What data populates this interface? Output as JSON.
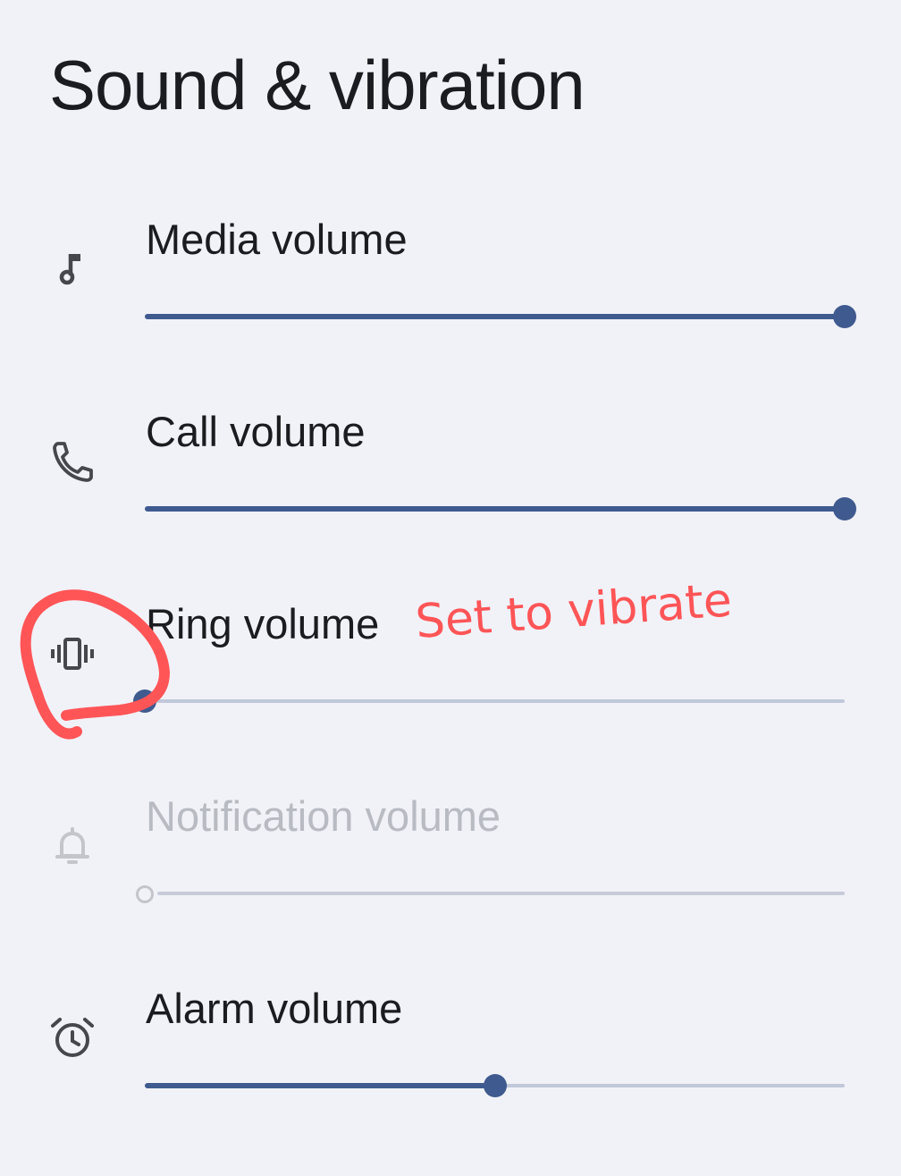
{
  "header": {
    "title": "Sound & vibration"
  },
  "rows": [
    {
      "label": "Media volume",
      "icon": "music-note-icon",
      "level_percent": 100,
      "enabled": true
    },
    {
      "label": "Call volume",
      "icon": "phone-icon",
      "level_percent": 100,
      "enabled": true
    },
    {
      "label": "Ring volume",
      "icon": "vibrate-icon",
      "level_percent": 0,
      "enabled": true
    },
    {
      "label": "Notification volume",
      "icon": "bell-icon",
      "level_percent": 0,
      "enabled": false
    },
    {
      "label": "Alarm volume",
      "icon": "alarm-clock-icon",
      "level_percent": 50,
      "enabled": true
    }
  ],
  "annotation": {
    "text": "Set to vibrate",
    "color": "#ff5557"
  },
  "colors": {
    "accent": "#3f5a8f",
    "background": "#f1f2f8",
    "track_inactive": "#c0c8da"
  }
}
